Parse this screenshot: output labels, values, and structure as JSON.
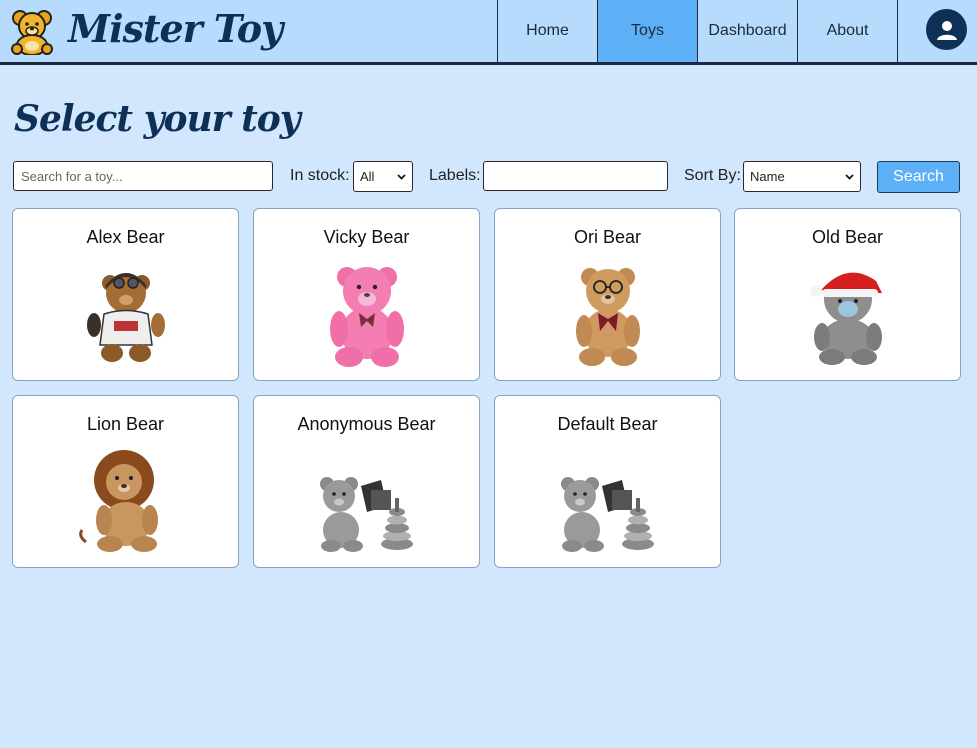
{
  "brand": {
    "name": "Mister Toy"
  },
  "nav": {
    "items": [
      {
        "label": "Home"
      },
      {
        "label": "Toys"
      },
      {
        "label": "Dashboard"
      },
      {
        "label": "About"
      }
    ],
    "active": "Toys"
  },
  "page": {
    "title": "Select your toy"
  },
  "filters": {
    "search_placeholder": "Search for a toy...",
    "in_stock_label": "In stock:",
    "in_stock_value": "All",
    "labels_label": "Labels:",
    "labels_value": "",
    "sort_label": "Sort By:",
    "sort_value": "Name",
    "search_button": "Search"
  },
  "toys": [
    {
      "name": "Alex Bear",
      "image": "aviator-bear"
    },
    {
      "name": "Vicky Bear",
      "image": "pink-bear"
    },
    {
      "name": "Ori Bear",
      "image": "glasses-bear"
    },
    {
      "name": "Old Bear",
      "image": "santa-hat-grey-bear"
    },
    {
      "name": "Lion Bear",
      "image": "lion-bear"
    },
    {
      "name": "Anonymous Bear",
      "image": "placeholder-grey-toys"
    },
    {
      "name": "Default Bear",
      "image": "placeholder-grey-toys"
    }
  ],
  "colors": {
    "page_bg": "#d2e7fd",
    "header_bg": "#b6dbfd",
    "accent": "#5eb0f6",
    "brand_dark": "#0e3056"
  }
}
